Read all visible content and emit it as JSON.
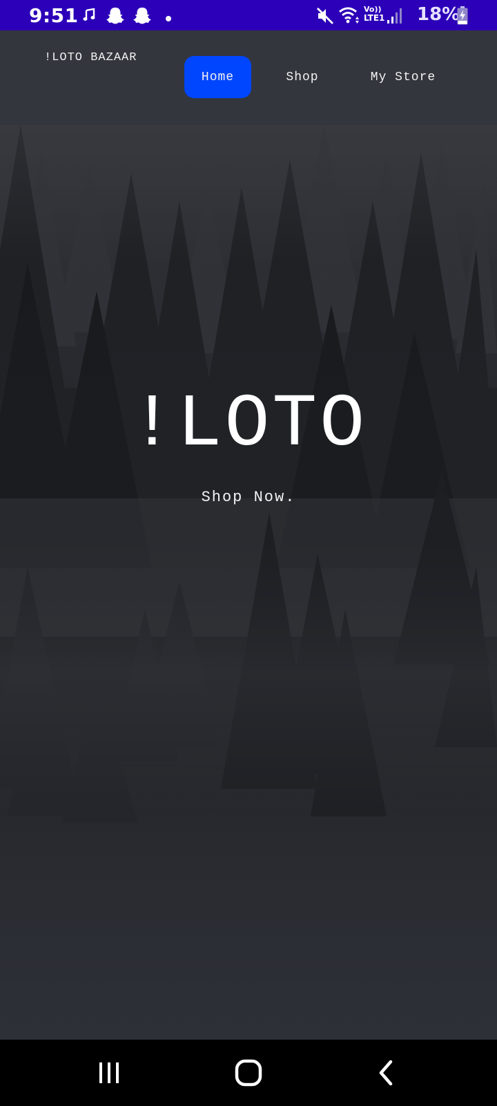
{
  "status_bar": {
    "time": "9:51",
    "battery": "18%",
    "network_label_top": "Vo))",
    "network_label_bottom": "LTE1",
    "icons": [
      "music-note-icon",
      "snapchat-icon",
      "snapchat-icon",
      "notification-dot-icon",
      "mute-icon",
      "wifi-icon",
      "signal-icon",
      "battery-charging-icon"
    ],
    "color": "#2c00b8"
  },
  "header": {
    "brand": "!LOTO BAZAAR",
    "nav": [
      {
        "label": "Home",
        "active": true
      },
      {
        "label": "Shop",
        "active": false
      },
      {
        "label": "My Store",
        "active": false
      }
    ],
    "accent_color": "#0046ff"
  },
  "hero": {
    "title": "!LOTO",
    "cta": "Shop Now.",
    "background": "misty pine forest"
  },
  "navigation_bar": {
    "buttons": [
      "recents-icon",
      "home-icon",
      "back-icon"
    ]
  }
}
